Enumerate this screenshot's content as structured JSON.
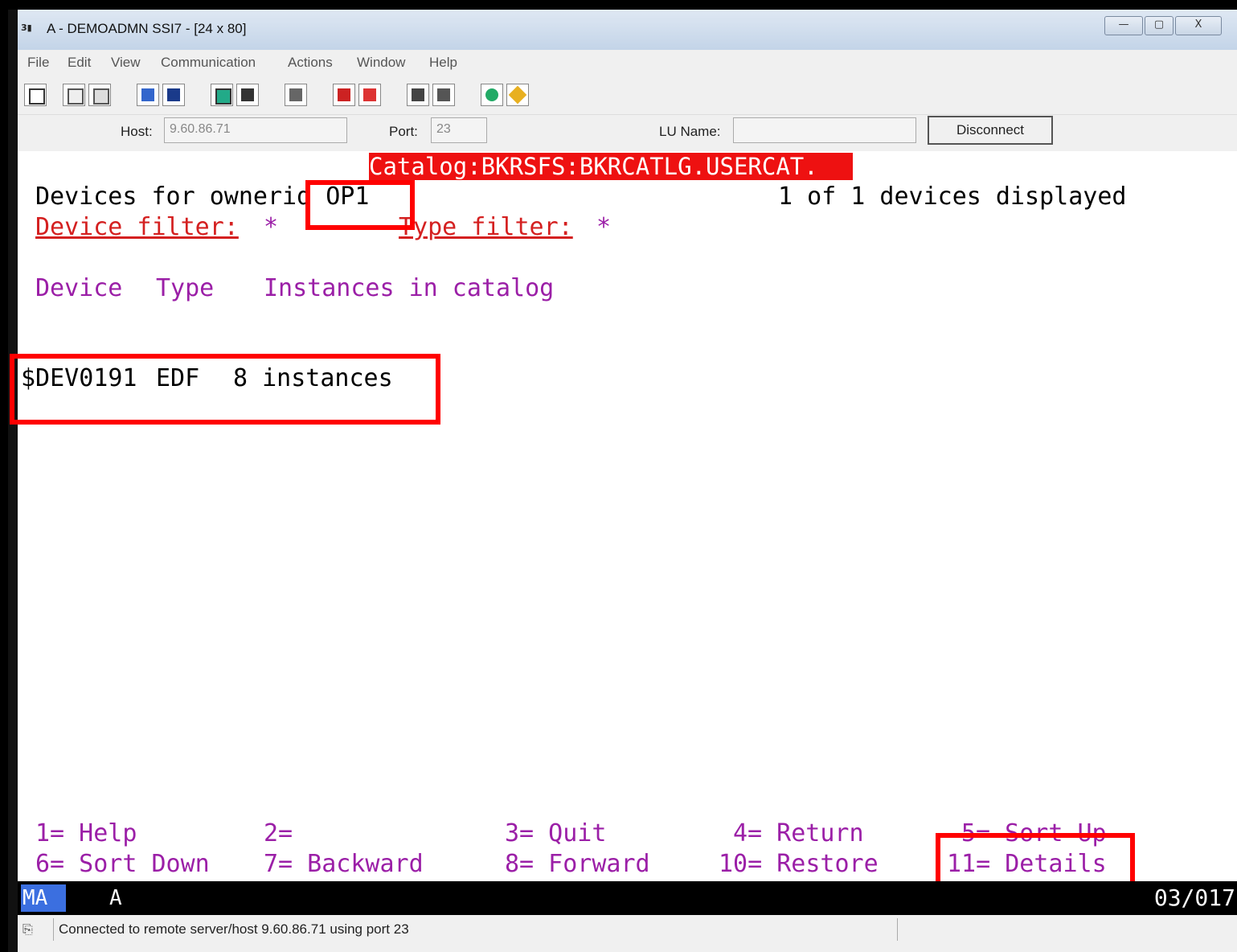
{
  "window": {
    "title": "A - DEMOADMN SSI7 - [24 x 80]",
    "minimize": "—",
    "maximize": "▢",
    "close": "X"
  },
  "menu": [
    "File",
    "Edit",
    "View",
    "Communication",
    "Actions",
    "Window",
    "Help"
  ],
  "connection": {
    "host_label": "Host:",
    "host_value": "9.60.86.71",
    "port_label": "Port:",
    "port_value": "23",
    "lu_label": "LU Name:",
    "lu_value": "",
    "disconnect": "Disconnect"
  },
  "screen": {
    "catalog": "Catalog:BKRSFS:BKRCATLG.USERCAT.",
    "devices_for": "Devices for ownerid OP1",
    "count": "1 of 1 devices displayed",
    "device_filter_label": "Device filter:",
    "device_filter_value": "*",
    "type_filter_label": "Type filter:",
    "type_filter_value": "*",
    "col_device": "Device",
    "col_type": "Type",
    "col_instances": "Instances in catalog",
    "rows": [
      {
        "device": "$DEV0191",
        "type": "EDF",
        "instances": "8 instances"
      }
    ],
    "pf_row1": [
      "1= Help",
      "2=",
      "3= Quit",
      "4= Return",
      "5= Sort Up"
    ],
    "pf_row2": [
      "6= Sort Down",
      "7= Backward",
      "8= Forward",
      "10= Restore",
      "11= Details"
    ]
  },
  "oia": {
    "mode": "MA",
    "session": "A",
    "cursor": "03/017"
  },
  "status": {
    "message": "Connected to remote server/host 9.60.86.71 using port 23"
  },
  "colors": {
    "catalog_bg": "#ee1111",
    "pf_text": "#9b1fa7",
    "filter_text": "#d42020",
    "highlight": "#ff0000"
  }
}
